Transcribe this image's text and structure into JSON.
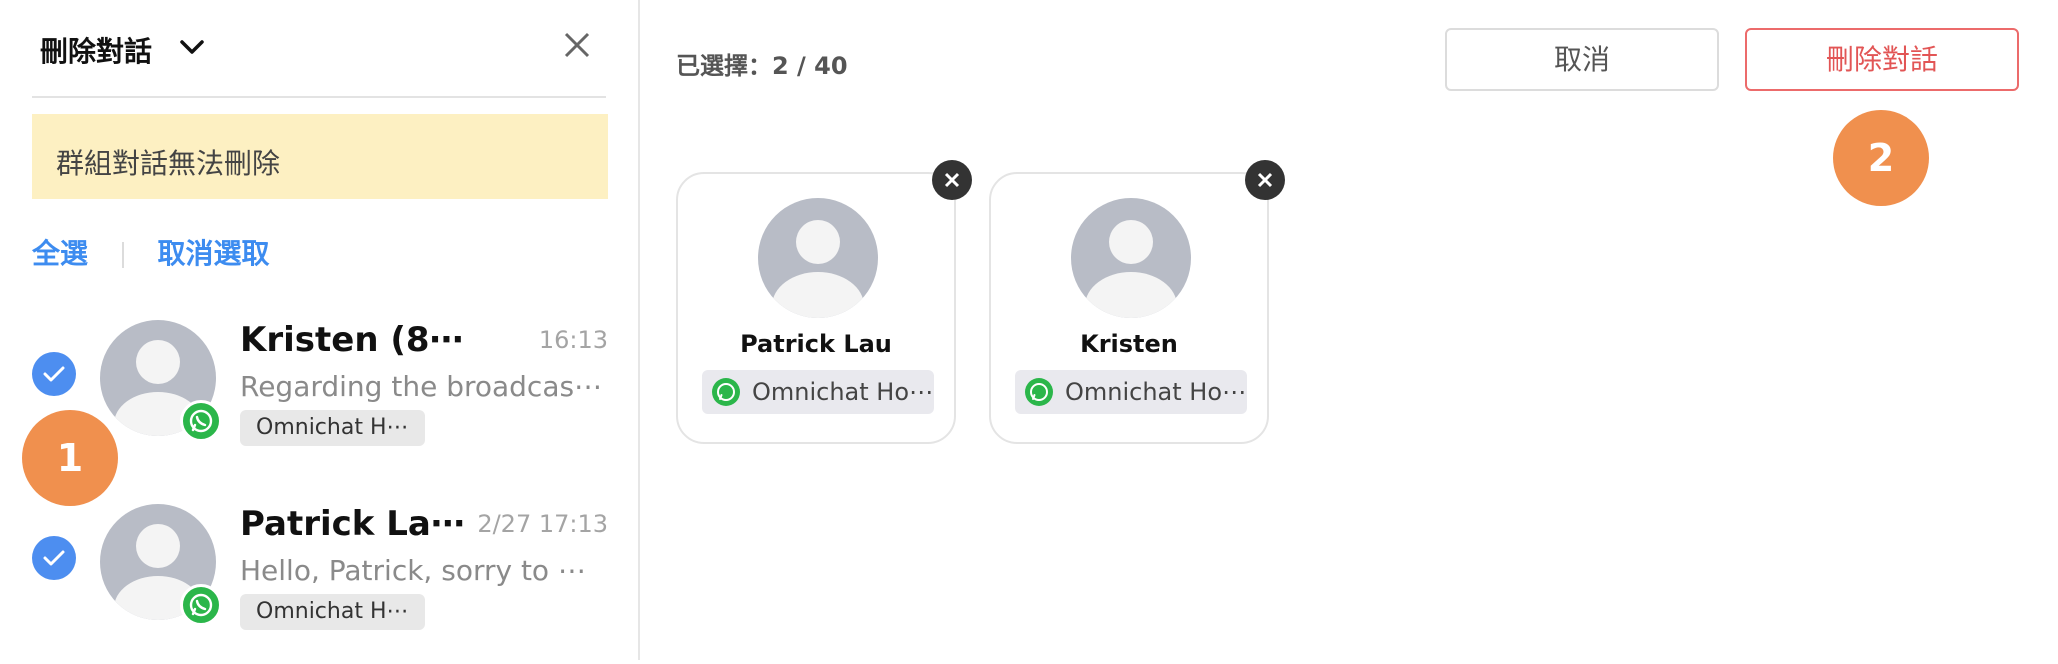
{
  "sidebar": {
    "title": "刪除對話",
    "warning": "群組對話無法刪除",
    "select_all": "全選",
    "deselect": "取消選取",
    "conversations": [
      {
        "name": "Kristen (8⋯",
        "time": "16:13",
        "preview": "Regarding the broadcas⋯",
        "channel": "Omnichat H⋯",
        "checked": true,
        "channel_icon": "whatsapp-icon"
      },
      {
        "name": "Patrick La⋯",
        "time": "2/27 17:13",
        "preview": "Hello, Patrick, sorry to ⋯",
        "channel": "Omnichat H⋯",
        "checked": true,
        "channel_icon": "whatsapp-icon"
      }
    ]
  },
  "main": {
    "selected_count": "已選擇：2 / 40",
    "cancel_label": "取消",
    "delete_label": "刪除對話",
    "cards": [
      {
        "name": "Patrick Lau",
        "channel": "Omnichat Ho⋯",
        "channel_icon": "whatsapp-icon"
      },
      {
        "name": "Kristen",
        "channel": "Omnichat Ho⋯",
        "channel_icon": "whatsapp-icon"
      }
    ]
  },
  "step_markers": [
    "1",
    "2"
  ],
  "colors": {
    "accent_blue": "#4d8ef0",
    "danger_red": "#e25555",
    "warning_bg": "#fdf0c2",
    "step_orange": "#f0904e",
    "whatsapp_green": "#2bb64a"
  }
}
